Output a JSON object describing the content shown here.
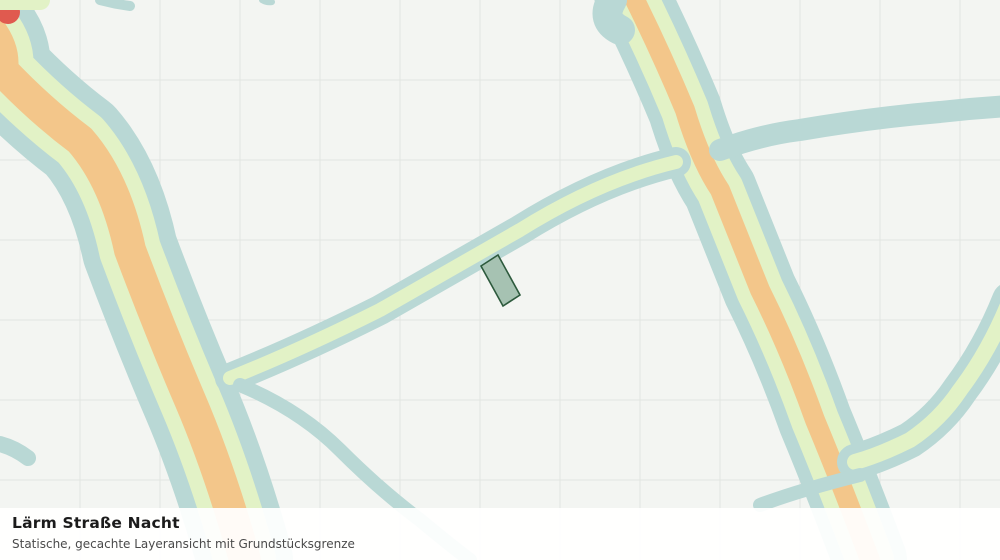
{
  "map": {
    "background_color": "#f3f5f2",
    "grid_color": "#e2e5e1",
    "noise_bands": [
      {
        "level": "outer",
        "color": "#b9d8d5"
      },
      {
        "level": "low",
        "color": "#e2f2c6"
      },
      {
        "level": "medium",
        "color": "#f3c68a"
      },
      {
        "level": "high",
        "color": "#e05a4f"
      }
    ],
    "parcel": {
      "fill": "#a6c2b2",
      "stroke": "#2d5a3d"
    }
  },
  "caption": {
    "title": "Lärm Straße Nacht",
    "subtitle": "Statische, gecachte Layeransicht mit Grundstücksgrenze"
  }
}
